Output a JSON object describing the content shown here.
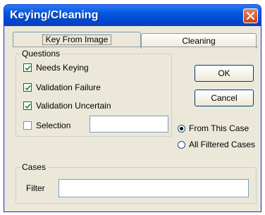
{
  "window": {
    "title": "Keying/Cleaning"
  },
  "tabs": [
    {
      "label": "Key From Image",
      "selected": true
    },
    {
      "label": "Cleaning",
      "selected": false
    }
  ],
  "questions": {
    "title": "Questions",
    "items": [
      {
        "label": "Needs Keying",
        "checked": true
      },
      {
        "label": "Validation Failure",
        "checked": true
      },
      {
        "label": "Validation Uncertain",
        "checked": true
      },
      {
        "label": "Selection",
        "checked": false
      }
    ],
    "selection_value": ""
  },
  "buttons": {
    "ok": "OK",
    "cancel": "Cancel"
  },
  "scope": {
    "options": [
      {
        "label": "From This Case",
        "selected": true
      },
      {
        "label": "All Filtered Cases",
        "selected": false
      }
    ]
  },
  "cases": {
    "title": "Cases",
    "filter_label": "Filter",
    "filter_value": ""
  },
  "colors": {
    "titlebar": "#0a5ae0",
    "dialog_bg": "#ebe8d9",
    "close_button": "#c9421c"
  }
}
